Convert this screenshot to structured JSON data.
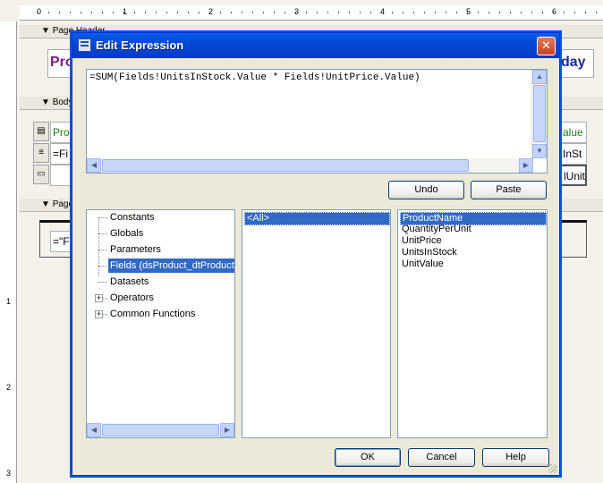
{
  "background": {
    "ruler_numbers": [
      "0",
      "1",
      "2",
      "3",
      "4",
      "5",
      "6"
    ],
    "left_ruler_numbers": [
      "1",
      "2",
      "3"
    ],
    "page_header_band": "Page Header",
    "body_band": "Body",
    "page_footer_band": "Page",
    "header_left_fragment": "Pro",
    "header_right_fragment": "day",
    "row1_left_fragment": "Pro",
    "row1_right_fragment": "alue",
    "row2_left_fragment": "=Fi",
    "row2_right_fragment": "InSt",
    "row3_right_fragment": "lUnit",
    "footer_fragment": "=\"F"
  },
  "dialog": {
    "title": "Edit Expression",
    "close_glyph": "✕",
    "expression": "=SUM(Fields!UnitsInStock.Value * Fields!UnitPrice.Value)",
    "undo_label": "Undo",
    "paste_label": "Paste",
    "tree": {
      "items": [
        {
          "label": "Constants",
          "expandable": false,
          "selected": false
        },
        {
          "label": "Globals",
          "expandable": false,
          "selected": false
        },
        {
          "label": "Parameters",
          "expandable": false,
          "selected": false
        },
        {
          "label": "Fields (dsProduct_dtProductL",
          "expandable": false,
          "selected": true
        },
        {
          "label": "Datasets",
          "expandable": false,
          "selected": false
        },
        {
          "label": "Operators",
          "expandable": true,
          "selected": false
        },
        {
          "label": "Common Functions",
          "expandable": true,
          "selected": false
        }
      ]
    },
    "category_list": [
      "<All>"
    ],
    "field_list": [
      "ProductName",
      "QuantityPerUnit",
      "UnitPrice",
      "UnitsInStock",
      "UnitValue"
    ],
    "ok_label": "OK",
    "cancel_label": "Cancel",
    "help_label": "Help"
  },
  "colors": {
    "title_bar": "#0548d8",
    "selection": "#316ac5",
    "dialog_face": "#ece9d8",
    "header_text_purple": "#7a1f7a",
    "header_text_blue": "#1a2a9a",
    "green_text": "#1a7a1a"
  }
}
